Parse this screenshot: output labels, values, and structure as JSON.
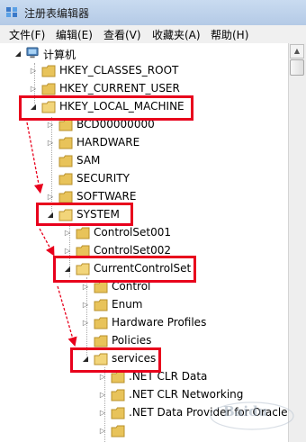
{
  "window": {
    "title": "注册表编辑器"
  },
  "menu": [
    "文件(F)",
    "编辑(E)",
    "查看(V)",
    "收藏夹(A)",
    "帮助(H)"
  ],
  "tree": {
    "computer": "计算机",
    "hkcr": "HKEY_CLASSES_ROOT",
    "hkcu": "HKEY_CURRENT_USER",
    "hklm": "HKEY_LOCAL_MACHINE",
    "bcd": "BCD00000000",
    "hardware": "HARDWARE",
    "sam": "SAM",
    "security": "SECURITY",
    "software": "SOFTWARE",
    "system": "SYSTEM",
    "controlset001": "ControlSet001",
    "controlset002": "ControlSet002",
    "currentcontrolset": "CurrentControlSet",
    "control": "Control",
    "enum": "Enum",
    "hardware_profiles": "Hardware Profiles",
    "policies": "Policies",
    "services": "services",
    "net_clr_data": ".NET CLR Data",
    "net_clr_networking": ".NET CLR Networking",
    "net_data_provider_oracle": ".NET Data Provider for Oracle"
  },
  "watermark": "Baidu",
  "colors": {
    "highlight": "#e8001c",
    "folder": "#e8c35a",
    "titlebar": "#c9dbf0"
  }
}
